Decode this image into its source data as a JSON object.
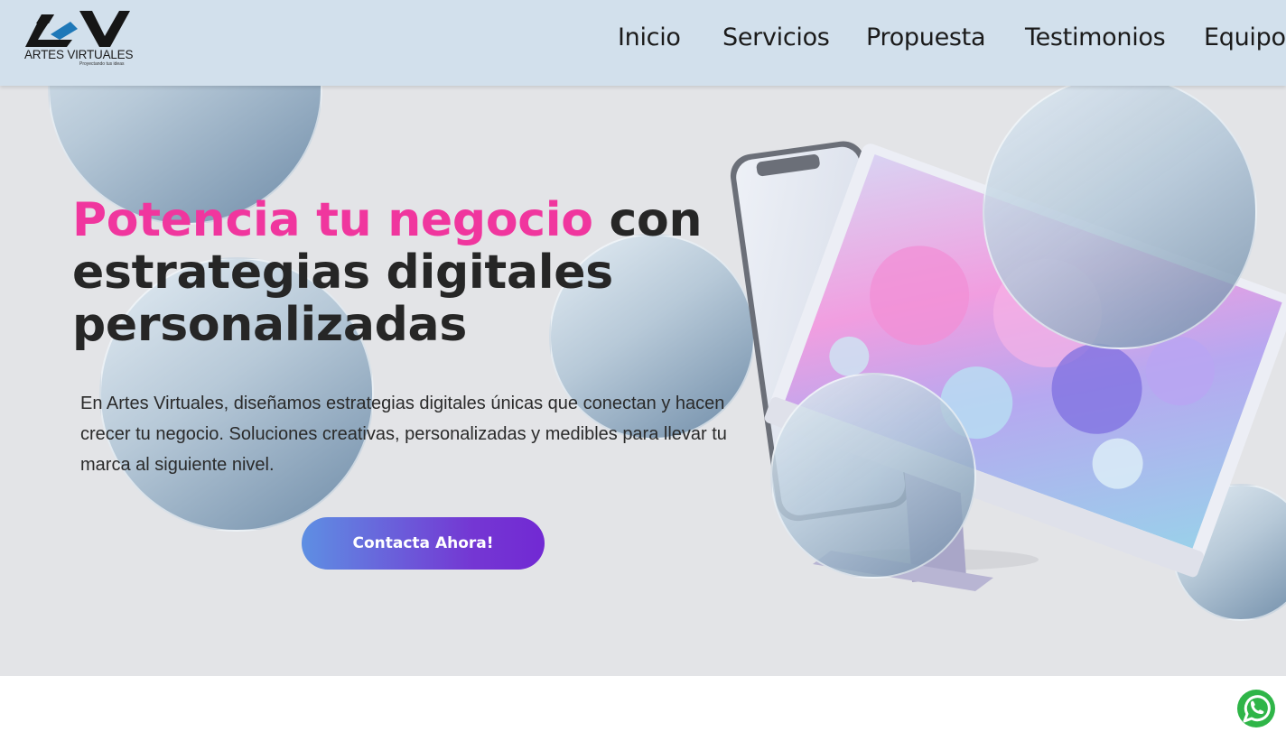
{
  "header": {
    "logo": {
      "name": "ARTES VIRTUALES",
      "tagline": "Proyectando tus ideas",
      "icon": "av-logo-icon"
    },
    "nav": [
      {
        "label": "Inicio"
      },
      {
        "label": "Servicios"
      },
      {
        "label": "Propuesta"
      },
      {
        "label": "Testimonios"
      },
      {
        "label": "Equipo"
      }
    ]
  },
  "hero": {
    "title_highlight": "Potencia tu negocio",
    "title_rest": " con estrategias digitales personalizadas",
    "description": "En Artes Virtuales, diseñamos estrategias digitales únicas que conectan y hacen crecer tu negocio. Soluciones creativas, personalizadas y medibles para llevar tu marca al siguiente nivel.",
    "cta_label": "Contacta Ahora!"
  },
  "floating": {
    "icon": "whatsapp-icon"
  },
  "colors": {
    "header_bg": "#d2e0ec",
    "hero_bg": "#e3e4e7",
    "title_highlight": "#f0369e",
    "cta_gradient_start": "#5e8fe3",
    "cta_gradient_end": "#7229d3",
    "whatsapp": "#2fb548"
  }
}
